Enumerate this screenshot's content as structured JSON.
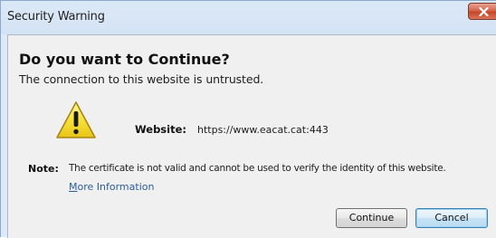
{
  "window": {
    "title": "Security Warning",
    "close_icon": "close-x-icon"
  },
  "dialog": {
    "heading": "Do you want to Continue?",
    "subheading": "The connection to this website is untrusted.",
    "warning_icon": "warning-triangle-icon",
    "website_label": "Website:",
    "website_value": "https://www.eacat.cat:443",
    "note_label": "Note:",
    "note_text": "The certificate is not valid and cannot be used to verify the identity of this website.",
    "more_info_accel": "M",
    "more_info_rest": "ore Information"
  },
  "buttons": {
    "continue_label": "Continue",
    "cancel_label": "Cancel"
  },
  "colors": {
    "close_button": "#c74628",
    "link": "#2a5f9a",
    "warning_fill": "#f7e23c"
  }
}
